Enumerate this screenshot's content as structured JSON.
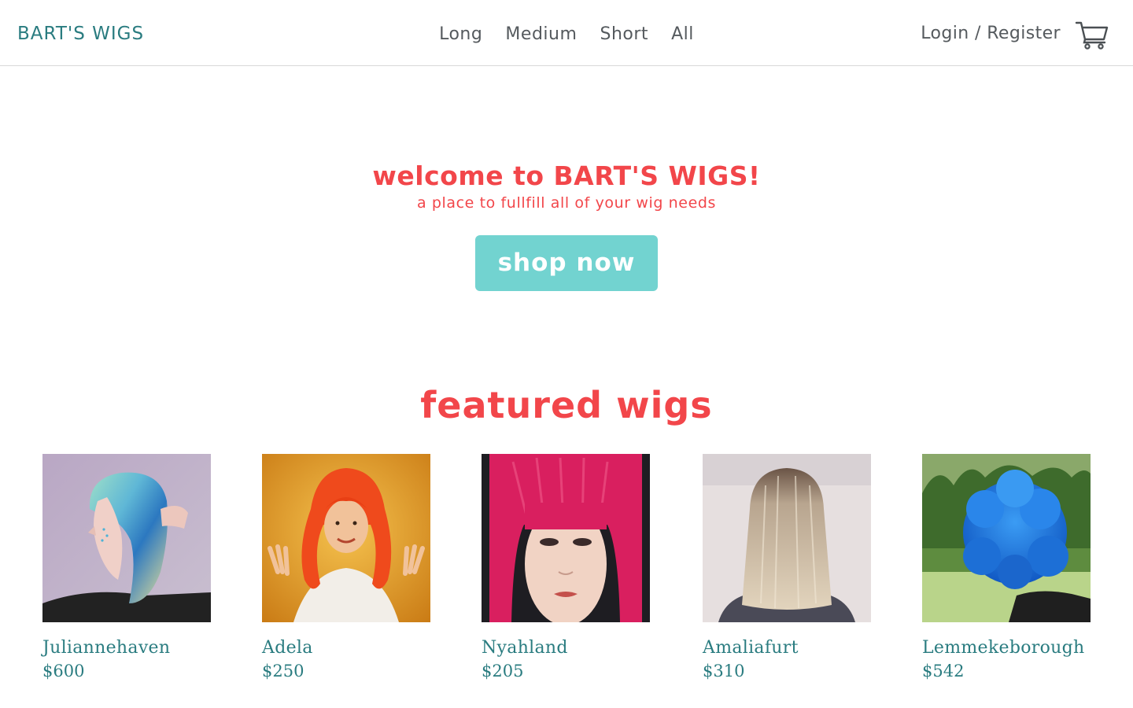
{
  "brand": {
    "name": "BART'S WIGS"
  },
  "nav": {
    "links": [
      {
        "label": "Long"
      },
      {
        "label": "Medium"
      },
      {
        "label": "Short"
      },
      {
        "label": "All"
      }
    ],
    "login_label": "Login / Register",
    "cart_icon": "shopping-cart-icon"
  },
  "hero": {
    "title": "welcome to BART'S WIGS!",
    "subtitle": "a place to fullfill all of your wig needs",
    "button_label": "shop now"
  },
  "featured": {
    "title": "featured wigs",
    "products": [
      {
        "name": "Juliannehaven",
        "price": "$600"
      },
      {
        "name": "Adela",
        "price": "$250"
      },
      {
        "name": "Nyahland",
        "price": "$205"
      },
      {
        "name": "Amaliafurt",
        "price": "$310"
      },
      {
        "name": "Lemmekeborough",
        "price": "$542"
      }
    ]
  },
  "colors": {
    "brand_teal": "#2a7c80",
    "accent_red": "#f2464a",
    "button_teal": "#72d3d0",
    "nav_text": "#555a5e"
  }
}
